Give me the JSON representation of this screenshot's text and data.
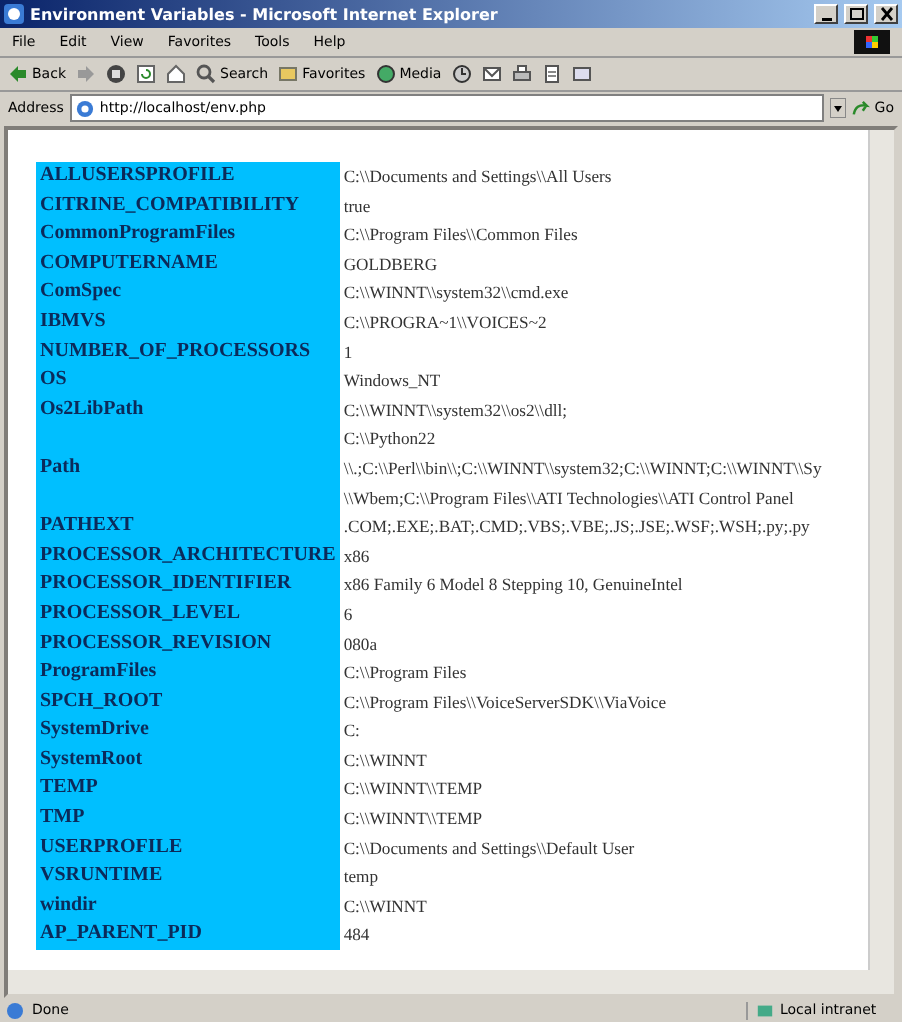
{
  "window": {
    "title": "Environment Variables - Microsoft Internet Explorer"
  },
  "menu": [
    "File",
    "Edit",
    "View",
    "Favorites",
    "Tools",
    "Help"
  ],
  "toolbar": [
    {
      "kind": "back",
      "label": "Back"
    },
    {
      "kind": "forward"
    },
    {
      "kind": "stop"
    },
    {
      "kind": "refresh"
    },
    {
      "kind": "home"
    },
    {
      "kind": "search",
      "label": "Search"
    },
    {
      "kind": "favorites",
      "label": "Favorites"
    },
    {
      "kind": "media",
      "label": "Media"
    },
    {
      "kind": "history"
    },
    {
      "kind": "mail"
    },
    {
      "kind": "print"
    },
    {
      "kind": "edit"
    },
    {
      "kind": "discuss"
    }
  ],
  "address": {
    "label": "Address",
    "value": "http://localhost/env.php",
    "go": "Go"
  },
  "table": {
    "rows": [
      {
        "name": "ALLUSERSPROFILE",
        "value": [
          "C:\\\\Documents and Settings\\\\All Users"
        ]
      },
      {
        "name": "CITRINE_COMPATIBILITY",
        "value": [
          "true"
        ]
      },
      {
        "name": "CommonProgramFiles",
        "value": [
          "C:\\\\Program Files\\\\Common Files"
        ]
      },
      {
        "name": "COMPUTERNAME",
        "value": [
          "GOLDBERG"
        ]
      },
      {
        "name": "ComSpec",
        "value": [
          "C:\\\\WINNT\\\\system32\\\\cmd.exe"
        ]
      },
      {
        "name": "IBMVS",
        "value": [
          "C:\\\\PROGRA~1\\\\VOICES~2"
        ]
      },
      {
        "name": "NUMBER_OF_PROCESSORS",
        "value": [
          "1"
        ]
      },
      {
        "name": "OS",
        "value": [
          "Windows_NT"
        ]
      },
      {
        "name": "Os2LibPath",
        "value": [
          "C:\\\\WINNT\\\\system32\\\\os2\\\\dll;"
        ]
      },
      {
        "name": "Path",
        "value": [
          "C:\\\\Python22",
          "\\\\.;C:\\\\Perl\\\\bin\\\\;C:\\\\WINNT\\\\system32;C:\\\\WINNT;C:\\\\WINNT\\\\Sy",
          "\\\\Wbem;C:\\\\Program Files\\\\ATI Technologies\\\\ATI Control Panel"
        ]
      },
      {
        "name": "PATHEXT",
        "value": [
          ".COM;.EXE;.BAT;.CMD;.VBS;.VBE;.JS;.JSE;.WSF;.WSH;.py;.py"
        ]
      },
      {
        "name": "PROCESSOR_ARCHITECTURE",
        "value": [
          "x86"
        ]
      },
      {
        "name": "PROCESSOR_IDENTIFIER",
        "value": [
          "x86 Family 6 Model 8 Stepping 10, GenuineIntel"
        ]
      },
      {
        "name": "PROCESSOR_LEVEL",
        "value": [
          "6"
        ]
      },
      {
        "name": "PROCESSOR_REVISION",
        "value": [
          "080a"
        ]
      },
      {
        "name": "ProgramFiles",
        "value": [
          "C:\\\\Program Files"
        ]
      },
      {
        "name": "SPCH_ROOT",
        "value": [
          "C:\\\\Program Files\\\\VoiceServerSDK\\\\ViaVoice"
        ]
      },
      {
        "name": "SystemDrive",
        "value": [
          "C:"
        ]
      },
      {
        "name": "SystemRoot",
        "value": [
          "C:\\\\WINNT"
        ]
      },
      {
        "name": "TEMP",
        "value": [
          "C:\\\\WINNT\\\\TEMP"
        ]
      },
      {
        "name": "TMP",
        "value": [
          "C:\\\\WINNT\\\\TEMP"
        ]
      },
      {
        "name": "USERPROFILE",
        "value": [
          "C:\\\\Documents and Settings\\\\Default User"
        ]
      },
      {
        "name": "VSRUNTIME",
        "value": [
          "temp"
        ]
      },
      {
        "name": "windir",
        "value": [
          "C:\\\\WINNT"
        ]
      },
      {
        "name": "AP_PARENT_PID",
        "value": [
          "484"
        ]
      }
    ]
  },
  "status_bar": {
    "text": "Done",
    "zone": "Local intranet"
  }
}
